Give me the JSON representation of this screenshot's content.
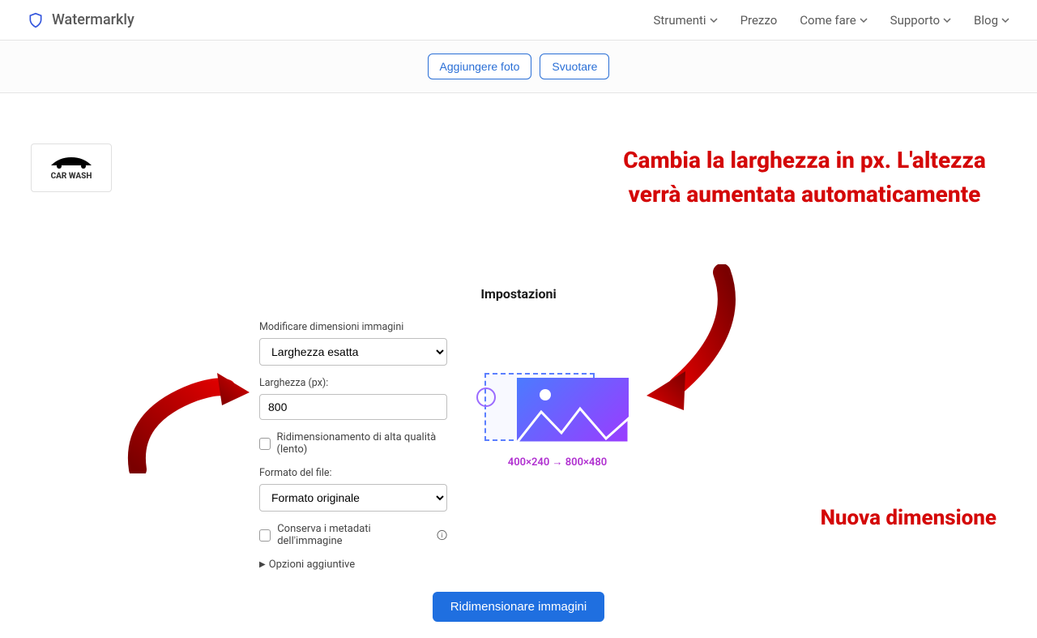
{
  "brand": {
    "name": "Watermarkly"
  },
  "nav": {
    "tools": "Strumenti",
    "price": "Prezzo",
    "howto": "Come fare",
    "support": "Supporto",
    "blog": "Blog"
  },
  "toolbar": {
    "add_photos": "Aggiungere foto",
    "clear": "Svuotare"
  },
  "thumb": {
    "text": "CAR WASH"
  },
  "annotations": {
    "main": "Cambia la larghezza in px. L'altezza verrà aumentata automaticamente",
    "new_dim": "Nuova dimensione"
  },
  "settings": {
    "title": "Impostazioni",
    "resize_mode_label": "Modificare dimensioni immagini",
    "resize_mode_value": "Larghezza esatta",
    "width_label": "Larghezza (px):",
    "width_value": "800",
    "hq_label": "Ridimensionamento di alta qualità (lento)",
    "format_label": "Formato del file:",
    "format_value": "Formato originale",
    "meta_label": "Conserva i metadati dell'immagine",
    "extra_label": "Opzioni aggiuntive",
    "dim_text": "400×240 → 800×480",
    "resize_btn": "Ridimensionare immagini"
  },
  "colors": {
    "accent_red": "#d40808",
    "primary_blue": "#1f6fe0"
  }
}
